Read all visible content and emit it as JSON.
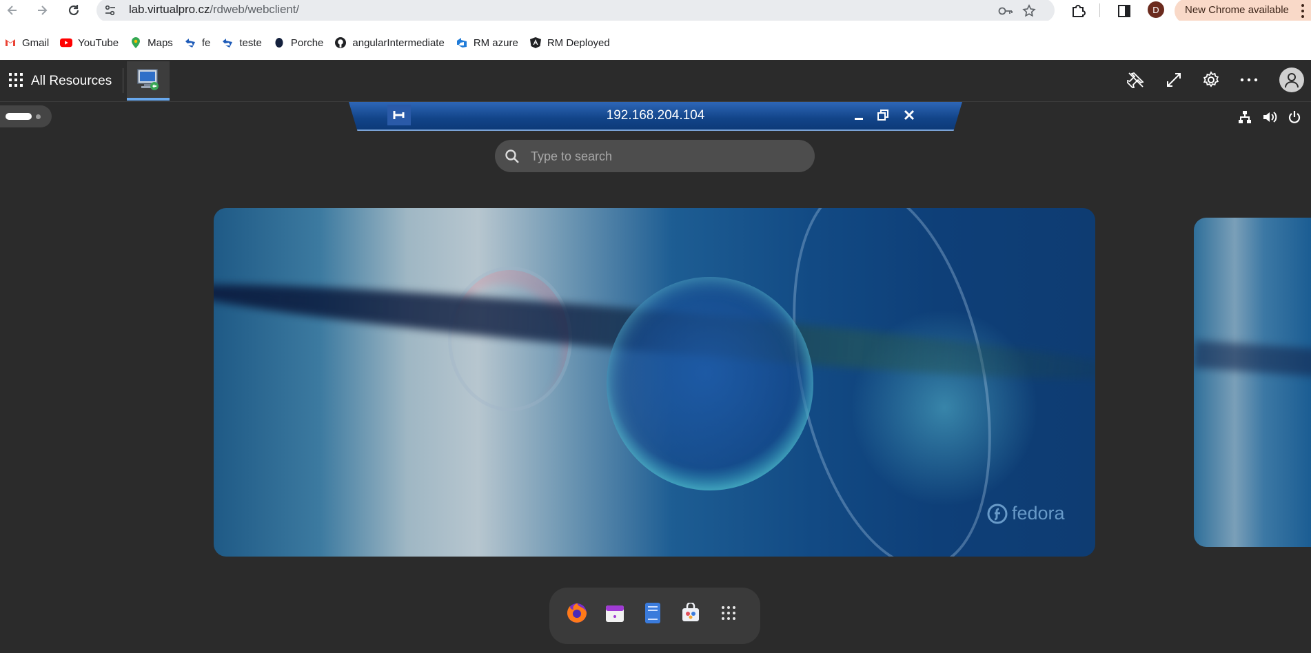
{
  "browser": {
    "url_host": "lab.virtualpro.cz",
    "url_path": "/rdweb/webclient/",
    "update_label": "New Chrome available",
    "profile_initial": "D"
  },
  "bookmarks": [
    {
      "label": "Gmail",
      "icon": "gmail-icon"
    },
    {
      "label": "YouTube",
      "icon": "youtube-icon"
    },
    {
      "label": "Maps",
      "icon": "maps-icon"
    },
    {
      "label": "fe",
      "icon": "azure-devops-icon"
    },
    {
      "label": "teste",
      "icon": "azure-devops-icon"
    },
    {
      "label": "Porche",
      "icon": "porche-icon"
    },
    {
      "label": "angularIntermediate",
      "icon": "github-icon"
    },
    {
      "label": "RM azure",
      "icon": "azure-devops-icon"
    },
    {
      "label": "RM Deployed",
      "icon": "angular-icon"
    }
  ],
  "rdweb": {
    "title": "All Resources"
  },
  "remote": {
    "host": "192.168.204.104",
    "search_placeholder": "Type to search",
    "wallpaper_brand": "fedora",
    "dock": [
      {
        "name": "firefox",
        "icon": "firefox-icon"
      },
      {
        "name": "calendar",
        "icon": "calendar-icon"
      },
      {
        "name": "text-editor",
        "icon": "text-editor-icon"
      },
      {
        "name": "software",
        "icon": "software-icon"
      },
      {
        "name": "show-apps",
        "icon": "app-grid-icon"
      }
    ]
  },
  "colors": {
    "rd_background": "#2b2b2b",
    "rdp_bar": "#124488",
    "accent_underline": "#69a9ee",
    "update_pill": "#f9d9c8"
  }
}
